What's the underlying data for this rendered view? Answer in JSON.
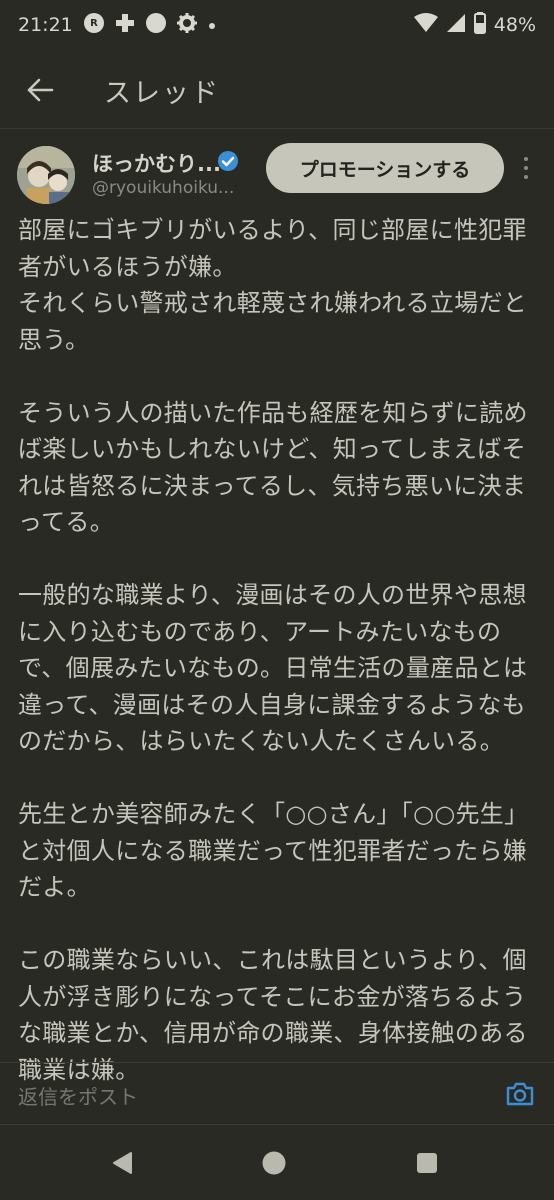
{
  "status_bar": {
    "time": "21:21",
    "battery_percent": "48%",
    "icons": [
      "rakuten-link-icon",
      "plus-icon",
      "circle-icon",
      "gear-icon",
      "dot-icon",
      "wifi-icon",
      "signal-icon",
      "battery-icon"
    ]
  },
  "header": {
    "title": "スレッド",
    "back_icon": "arrow-left-icon"
  },
  "post": {
    "author_name": "ほっかむり...",
    "author_handle": "@ryouikuhoiku...",
    "promote_label": "プロモーションする",
    "paragraphs": [
      "部屋にゴキブリがいるより、同じ部屋に性犯罪者がいるほうが嫌。\nそれくらい警戒され軽蔑され嫌われる立場だと思う。",
      "そういう人の描いた作品も経歴を知らずに読めば楽しいかもしれないけど、知ってしまえばそれは皆怒るに決まってるし、気持ち悪いに決まってる。",
      "一般的な職業より、漫画はその人の世界や思想に入り込むものであり、アートみたいなもので、個展みたいなもの。日常生活の量産品とは違って、漫画はその人自身に課金するようなものだから、はらいたくない人たくさんいる。",
      "先生とか美容師みたく「○○さん」「○○先生」と対個人になる職業だって性犯罪者だったら嫌だよ。",
      "この職業ならいい、これは駄目というより、個人が浮き彫りになってそこにお金が落ちるような職業とか、信用が命の職業、身体接触のある職業は嫌。"
    ]
  },
  "reply": {
    "placeholder": "返信をポスト"
  },
  "colors": {
    "background": "#2a2a24",
    "text": "#c5c5bc",
    "promote_button": "#c6c6bb",
    "verified_badge": "#3b8fd4"
  }
}
